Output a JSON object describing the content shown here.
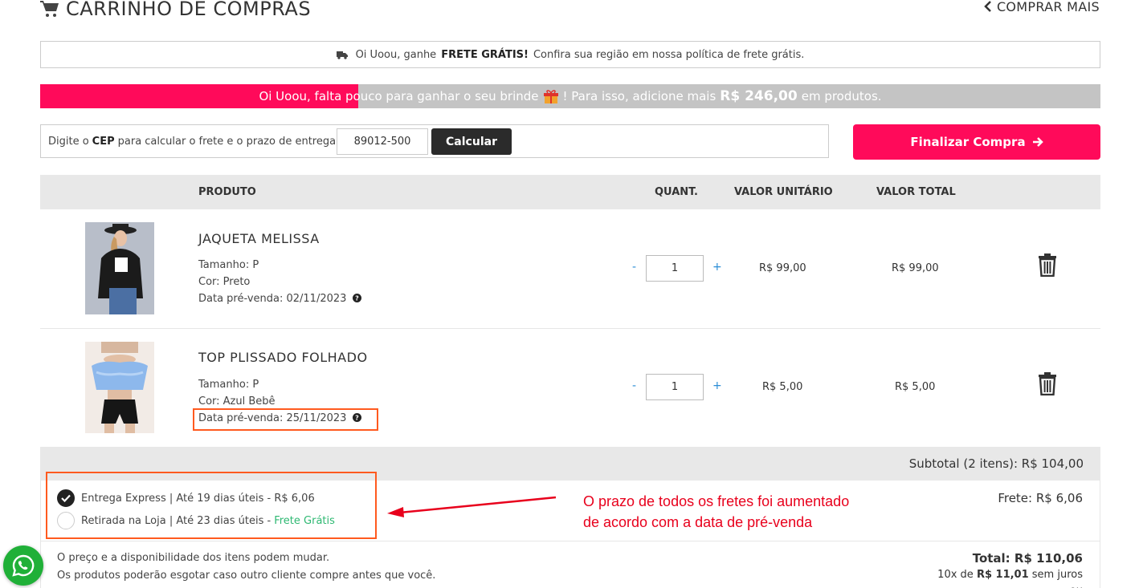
{
  "header": {
    "title": "CARRINHO DE COMPRAS",
    "buy_more": "COMPRAR MAIS"
  },
  "shipping_banner": {
    "prefix": "Oi Uoou, ganhe",
    "bold": "FRETE GRÁTIS!",
    "suffix": "Confira sua região em nossa política de frete grátis."
  },
  "progress": {
    "fill_fraction": 0.3,
    "text_before": "Oi Uoou, falta pouco para ganhar o seu brinde",
    "text_middle": "! Para isso, adicione mais",
    "amount": "R$ 246,00",
    "text_after": "em produtos."
  },
  "cep": {
    "label_prefix": "Digite o",
    "label_bold": "CEP",
    "label_suffix": "para calcular o frete e o prazo de entrega:",
    "value": "89012-500",
    "button": "Calcular"
  },
  "checkout": {
    "label": "Finalizar Compra"
  },
  "table": {
    "headers": [
      "PRODUTO",
      "QUANT.",
      "VALOR UNITÁRIO",
      "VALOR TOTAL"
    ]
  },
  "items": [
    {
      "name": "JAQUETA MELISSA",
      "size": "Tamanho: P",
      "color": "Cor: Preto",
      "presale": "Data pré-venda: 02/11/2023",
      "qty": "1",
      "unit_price": "R$ 99,00",
      "total_price": "R$ 99,00",
      "qty_minus": "-",
      "qty_plus": "+"
    },
    {
      "name": "TOP PLISSADO FOLHADO",
      "size": "Tamanho: P",
      "color": "Cor: Azul Bebê",
      "presale": "Data pré-venda: 25/11/2023",
      "qty": "1",
      "unit_price": "R$ 5,00",
      "total_price": "R$ 5,00",
      "qty_minus": "-",
      "qty_plus": "+"
    }
  ],
  "summary": {
    "subtotal": "Subtotal (2 itens): R$ 104,00",
    "shipping_options": [
      {
        "label": "Entrega Express | Até 19 dias úteis - R$ 6,06",
        "selected": true
      },
      {
        "label": "Retirada na Loja | Até 23 dias úteis -",
        "free": "Frete Grátis",
        "selected": false
      }
    ],
    "frete": "Frete: R$ 6,06",
    "disclaimer_1": "O preço e a disponibilidade dos itens podem mudar.",
    "disclaimer_2": "Os produtos poderão esgotar caso outro cliente compre antes que você.",
    "total": "Total: R$ 110,06",
    "installments_prefix": "10x de",
    "installments_amount": "R$ 11,01",
    "installments_suffix": "sem juros",
    "cut_off": "ou"
  },
  "annotation": {
    "line1": "O prazo de todos os fretes foi aumentado",
    "line2": "de acordo com a data de pré-venda"
  },
  "colors": {
    "brand": "#ff0a5a",
    "annotation": "#e8001c",
    "highlight": "#ff5a1f",
    "free_shipping": "#2eb872",
    "whatsapp": "#20b038"
  },
  "icons": [
    "cart-icon",
    "chevron-left-icon",
    "truck-icon",
    "gift-icon",
    "arrow-right-icon",
    "trash-icon",
    "question-circle-icon",
    "check-icon",
    "whatsapp-icon"
  ]
}
